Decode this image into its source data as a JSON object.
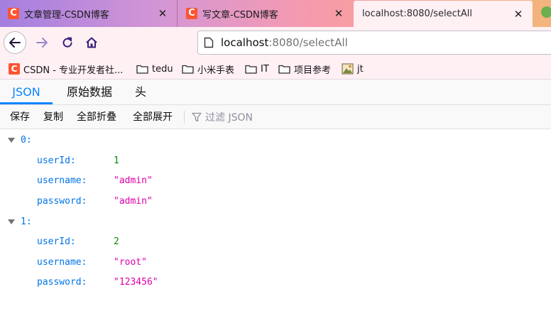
{
  "tabs": [
    {
      "title": "文章管理-CSDN博客",
      "favicon": "C"
    },
    {
      "title": "写文章-CSDN博客",
      "favicon": "C"
    },
    {
      "title": "localhost:8080/selectAll",
      "favicon": ""
    }
  ],
  "close_glyph": "✕",
  "url": {
    "host": "localhost",
    "rest": ":8080/selectAll"
  },
  "bookmarks": [
    {
      "label": "CSDN - 专业开发者社...",
      "icon": "csdn-favicon",
      "fav": "C"
    },
    {
      "label": "tedu",
      "icon": "folder-icon"
    },
    {
      "label": "小米手表",
      "icon": "folder-icon"
    },
    {
      "label": "IT",
      "icon": "folder-icon"
    },
    {
      "label": "项目参考",
      "icon": "folder-icon"
    },
    {
      "label": "jt",
      "icon": "image-icon"
    }
  ],
  "viewer": {
    "tabs": [
      "JSON",
      "原始数据",
      "头"
    ],
    "toolbar": {
      "save": "保存",
      "copy": "复制",
      "collapse_all": "全部折叠",
      "expand_all": "全部展开",
      "filter_placeholder": "过滤 JSON"
    }
  },
  "json": [
    {
      "index": "0:",
      "fields": [
        {
          "key": "userId:",
          "value": "1"
        },
        {
          "key": "username:",
          "value": "\"admin\""
        },
        {
          "key": "password:",
          "value": "\"admin\""
        }
      ]
    },
    {
      "index": "1:",
      "fields": [
        {
          "key": "userId:",
          "value": "2"
        },
        {
          "key": "username:",
          "value": "\"root\""
        },
        {
          "key": "password:",
          "value": "\"123456\""
        }
      ]
    }
  ],
  "colors": {
    "accent": "#0a84ff",
    "key": "#0074e8",
    "number": "#058b00",
    "string": "#dd00a9",
    "csdn": "#fc5531"
  }
}
